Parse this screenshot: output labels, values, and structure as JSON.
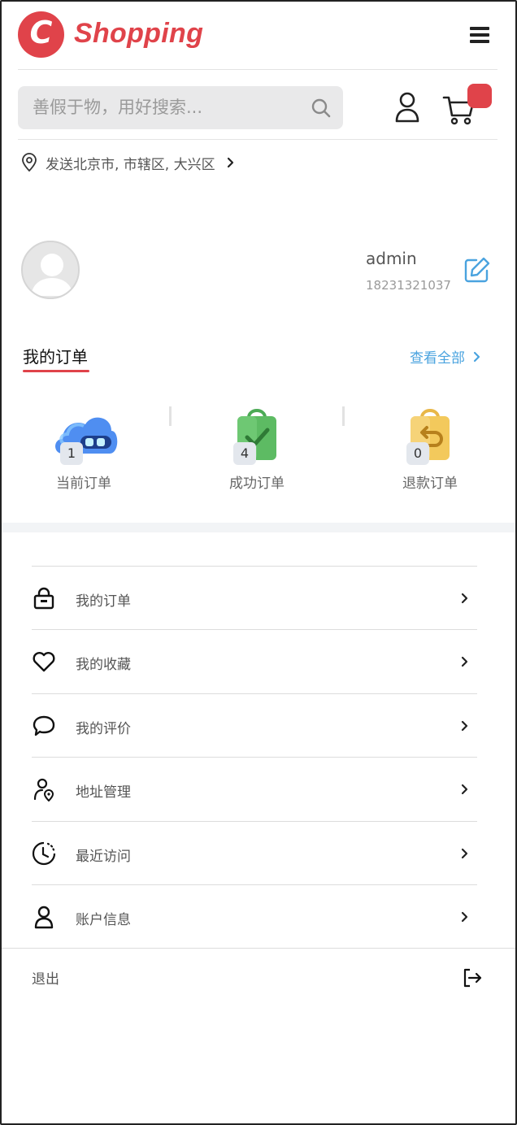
{
  "brand": {
    "logo_letter": "C",
    "name": "Shopping",
    "color": "#e0434a"
  },
  "header": {
    "menu_icon": "hamburger-icon"
  },
  "search": {
    "placeholder": "善假于物，用好搜索...",
    "value": ""
  },
  "delivery": {
    "text": "发送北京市, 市辖区, 大兴区"
  },
  "profile": {
    "username": "admin",
    "phone": "18231321037"
  },
  "orders": {
    "title": "我的订单",
    "view_all": "查看全部",
    "stats": [
      {
        "label": "当前订单",
        "count": "1"
      },
      {
        "label": "成功订单",
        "count": "4"
      },
      {
        "label": "退款订单",
        "count": "0"
      }
    ]
  },
  "menu": [
    {
      "label": "我的订单",
      "icon": "lock-bag-icon"
    },
    {
      "label": "我的收藏",
      "icon": "heart-icon"
    },
    {
      "label": "我的评价",
      "icon": "chat-bubble-icon"
    },
    {
      "label": "地址管理",
      "icon": "user-location-icon"
    },
    {
      "label": "最近访问",
      "icon": "clock-icon"
    },
    {
      "label": "账户信息",
      "icon": "user-icon"
    }
  ],
  "logout": {
    "label": "退出"
  }
}
